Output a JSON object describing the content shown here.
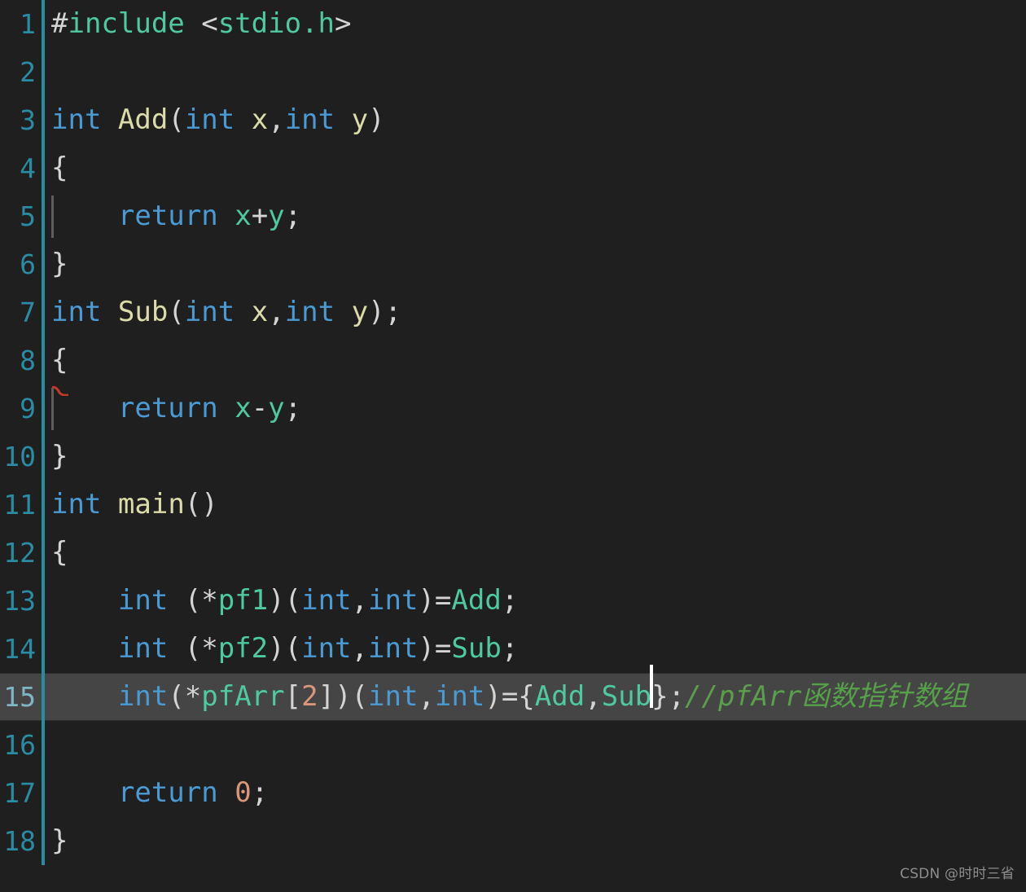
{
  "editor": {
    "language": "c",
    "total_lines": 18,
    "active_line": 15,
    "colors": {
      "background": "#1f1f1f",
      "active_line_background": "#454545",
      "gutter_rule": "#2a8ca3",
      "line_number": "#2a8ca3",
      "keyword": "#4a9ad4",
      "function": "#dcdcaa",
      "variable": "#4ec9a0",
      "number": "#d9967a",
      "punctuation": "#d4d4d4",
      "comment": "#5b9e4b",
      "caret": "#ffffff",
      "error_squiggle": "#c0392b",
      "indent_guide": "#5d5d5d"
    }
  },
  "lines": [
    {
      "number": "1",
      "tokens": [
        {
          "text": "#",
          "cls": "t-pp"
        },
        {
          "text": "include ",
          "cls": "t-inc"
        },
        {
          "text": "<",
          "cls": "t-punct"
        },
        {
          "text": "stdio.h",
          "cls": "t-inc"
        },
        {
          "text": ">",
          "cls": "t-punct"
        }
      ]
    },
    {
      "number": "2",
      "tokens": []
    },
    {
      "number": "3",
      "tokens": [
        {
          "text": "int",
          "cls": "t-kw"
        },
        {
          "text": " ",
          "cls": "t-punct"
        },
        {
          "text": "Add",
          "cls": "t-fn"
        },
        {
          "text": "(",
          "cls": "t-punct"
        },
        {
          "text": "int",
          "cls": "t-kw"
        },
        {
          "text": " ",
          "cls": "t-punct"
        },
        {
          "text": "x",
          "cls": "t-fn"
        },
        {
          "text": ",",
          "cls": "t-punct"
        },
        {
          "text": "int",
          "cls": "t-kw"
        },
        {
          "text": " ",
          "cls": "t-punct"
        },
        {
          "text": "y",
          "cls": "t-fn"
        },
        {
          "text": ")",
          "cls": "t-punct"
        }
      ]
    },
    {
      "number": "4",
      "tokens": [
        {
          "text": "{",
          "cls": "t-punct"
        }
      ]
    },
    {
      "number": "5",
      "indent_guide": true,
      "tokens": [
        {
          "text": "    ",
          "cls": "t-punct"
        },
        {
          "text": "return",
          "cls": "t-kw"
        },
        {
          "text": " ",
          "cls": "t-punct"
        },
        {
          "text": "x",
          "cls": "t-var"
        },
        {
          "text": "+",
          "cls": "t-punct"
        },
        {
          "text": "y",
          "cls": "t-var"
        },
        {
          "text": ";",
          "cls": "t-punct"
        }
      ]
    },
    {
      "number": "6",
      "tokens": [
        {
          "text": "}",
          "cls": "t-punct"
        }
      ]
    },
    {
      "number": "7",
      "tokens": [
        {
          "text": "int",
          "cls": "t-kw"
        },
        {
          "text": " ",
          "cls": "t-punct"
        },
        {
          "text": "Sub",
          "cls": "t-fn"
        },
        {
          "text": "(",
          "cls": "t-punct"
        },
        {
          "text": "int",
          "cls": "t-kw"
        },
        {
          "text": " ",
          "cls": "t-punct"
        },
        {
          "text": "x",
          "cls": "t-fn"
        },
        {
          "text": ",",
          "cls": "t-punct"
        },
        {
          "text": "int",
          "cls": "t-kw"
        },
        {
          "text": " ",
          "cls": "t-punct"
        },
        {
          "text": "y",
          "cls": "t-fn"
        },
        {
          "text": ");",
          "cls": "t-punct"
        }
      ]
    },
    {
      "number": "8",
      "tokens": [
        {
          "text": "{",
          "cls": "t-punct"
        }
      ]
    },
    {
      "number": "9",
      "indent_guide": true,
      "error_mark": true,
      "tokens": [
        {
          "text": "    ",
          "cls": "t-punct"
        },
        {
          "text": "return",
          "cls": "t-kw"
        },
        {
          "text": " ",
          "cls": "t-punct"
        },
        {
          "text": "x",
          "cls": "t-var"
        },
        {
          "text": "-",
          "cls": "t-punct"
        },
        {
          "text": "y",
          "cls": "t-var"
        },
        {
          "text": ";",
          "cls": "t-punct"
        }
      ]
    },
    {
      "number": "10",
      "tokens": [
        {
          "text": "}",
          "cls": "t-punct"
        }
      ]
    },
    {
      "number": "11",
      "tokens": [
        {
          "text": "int",
          "cls": "t-kw"
        },
        {
          "text": " ",
          "cls": "t-punct"
        },
        {
          "text": "main",
          "cls": "t-fn"
        },
        {
          "text": "()",
          "cls": "t-punct"
        }
      ]
    },
    {
      "number": "12",
      "tokens": [
        {
          "text": "{",
          "cls": "t-punct"
        }
      ]
    },
    {
      "number": "13",
      "tokens": [
        {
          "text": "    ",
          "cls": "t-punct"
        },
        {
          "text": "int",
          "cls": "t-kw"
        },
        {
          "text": " (*",
          "cls": "t-punct"
        },
        {
          "text": "pf1",
          "cls": "t-var"
        },
        {
          "text": ")(",
          "cls": "t-punct"
        },
        {
          "text": "int",
          "cls": "t-kw"
        },
        {
          "text": ",",
          "cls": "t-punct"
        },
        {
          "text": "int",
          "cls": "t-kw"
        },
        {
          "text": ")=",
          "cls": "t-punct"
        },
        {
          "text": "Add",
          "cls": "t-var"
        },
        {
          "text": ";",
          "cls": "t-punct"
        }
      ]
    },
    {
      "number": "14",
      "tokens": [
        {
          "text": "    ",
          "cls": "t-punct"
        },
        {
          "text": "int",
          "cls": "t-kw"
        },
        {
          "text": " (*",
          "cls": "t-punct"
        },
        {
          "text": "pf2",
          "cls": "t-var"
        },
        {
          "text": ")(",
          "cls": "t-punct"
        },
        {
          "text": "int",
          "cls": "t-kw"
        },
        {
          "text": ",",
          "cls": "t-punct"
        },
        {
          "text": "int",
          "cls": "t-kw"
        },
        {
          "text": ")=",
          "cls": "t-punct"
        },
        {
          "text": "Sub",
          "cls": "t-var"
        },
        {
          "text": ";",
          "cls": "t-punct"
        }
      ]
    },
    {
      "number": "15",
      "active": true,
      "caret_after_token": 14,
      "tokens": [
        {
          "text": "    ",
          "cls": "t-punct"
        },
        {
          "text": "int",
          "cls": "t-kw"
        },
        {
          "text": "(*",
          "cls": "t-punct"
        },
        {
          "text": "pfArr",
          "cls": "t-var"
        },
        {
          "text": "[",
          "cls": "t-punct"
        },
        {
          "text": "2",
          "cls": "t-num"
        },
        {
          "text": "])(",
          "cls": "t-punct"
        },
        {
          "text": "int",
          "cls": "t-kw"
        },
        {
          "text": ",",
          "cls": "t-punct"
        },
        {
          "text": "int",
          "cls": "t-kw"
        },
        {
          "text": ")={",
          "cls": "t-punct"
        },
        {
          "text": "Add",
          "cls": "t-var"
        },
        {
          "text": ",",
          "cls": "t-punct"
        },
        {
          "text": "Sub",
          "cls": "t-var"
        },
        {
          "text": "};",
          "cls": "t-punct"
        },
        {
          "text": "//pfArr",
          "cls": "t-comment"
        },
        {
          "text": "函数指针数组",
          "cls": "t-comment-cjk"
        }
      ]
    },
    {
      "number": "16",
      "tokens": []
    },
    {
      "number": "17",
      "tokens": [
        {
          "text": "    ",
          "cls": "t-punct"
        },
        {
          "text": "return",
          "cls": "t-kw"
        },
        {
          "text": " ",
          "cls": "t-punct"
        },
        {
          "text": "0",
          "cls": "t-num"
        },
        {
          "text": ";",
          "cls": "t-punct"
        }
      ]
    },
    {
      "number": "18",
      "tokens": [
        {
          "text": "}",
          "cls": "t-punct"
        }
      ]
    }
  ],
  "watermark": {
    "text": "CSDN @时时三省"
  }
}
